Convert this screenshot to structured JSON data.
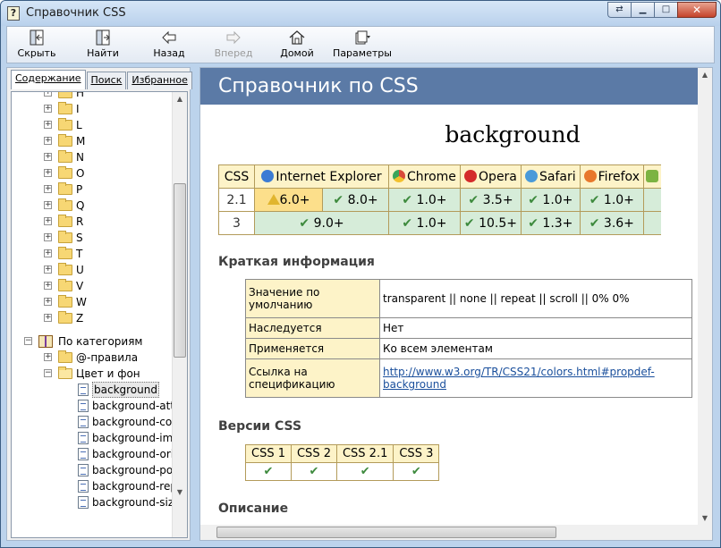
{
  "window": {
    "title": "Справочник CSS"
  },
  "toolbar": {
    "hide": "Скрыть",
    "find": "Найти",
    "back": "Назад",
    "forward": "Вперед",
    "home": "Домой",
    "options": "Параметры"
  },
  "tabs": [
    "Содержание",
    "Поиск",
    "Избранное"
  ],
  "tree": {
    "letters": [
      "H",
      "I",
      "L",
      "M",
      "N",
      "O",
      "P",
      "Q",
      "R",
      "S",
      "T",
      "U",
      "V",
      "W",
      "Z"
    ],
    "by_category": "По категориям",
    "at_rules": "@-правила",
    "color_bg": "Цвет и фон",
    "items": [
      "background",
      "background-atta",
      "background-colo",
      "background-ima",
      "background-origi",
      "background-pos",
      "background-rep",
      "background-size"
    ]
  },
  "content": {
    "header": "Справочник по CSS",
    "title": "background",
    "compat": {
      "headers": [
        "CSS",
        "Internet Explorer",
        "Chrome",
        "Opera",
        "Safari",
        "Firefox"
      ],
      "rows": [
        {
          "ver": "2.1",
          "ie_warn": "6.0+",
          "ie_ok": "8.0+",
          "chrome": "1.0+",
          "opera": "3.5+",
          "safari": "1.0+",
          "firefox": "1.0+"
        },
        {
          "ver": "3",
          "ie": "9.0+",
          "chrome": "1.0+",
          "opera": "10.5+",
          "safari": "1.3+",
          "firefox": "3.6+"
        }
      ]
    },
    "brief_heading": "Краткая информация",
    "brief": [
      {
        "k": "Значение по умолчанию",
        "v": "transparent || none || repeat || scroll || 0% 0%"
      },
      {
        "k": "Наследуется",
        "v": "Нет"
      },
      {
        "k": "Применяется",
        "v": "Ко всем элементам"
      },
      {
        "k": "Ссылка на спецификацию",
        "v": "http://www.w3.org/TR/CSS21/colors.html#propdef-background"
      }
    ],
    "versions_heading": "Версии CSS",
    "versions": [
      "CSS 1",
      "CSS 2",
      "CSS 2.1",
      "CSS 3"
    ],
    "description_heading": "Описание"
  },
  "colors": {
    "header_bar": "#5b7aa6",
    "ok_cell": "#d6ecd9",
    "warn_cell": "#fcdf8b",
    "th_bg": "#fdf3c8"
  }
}
